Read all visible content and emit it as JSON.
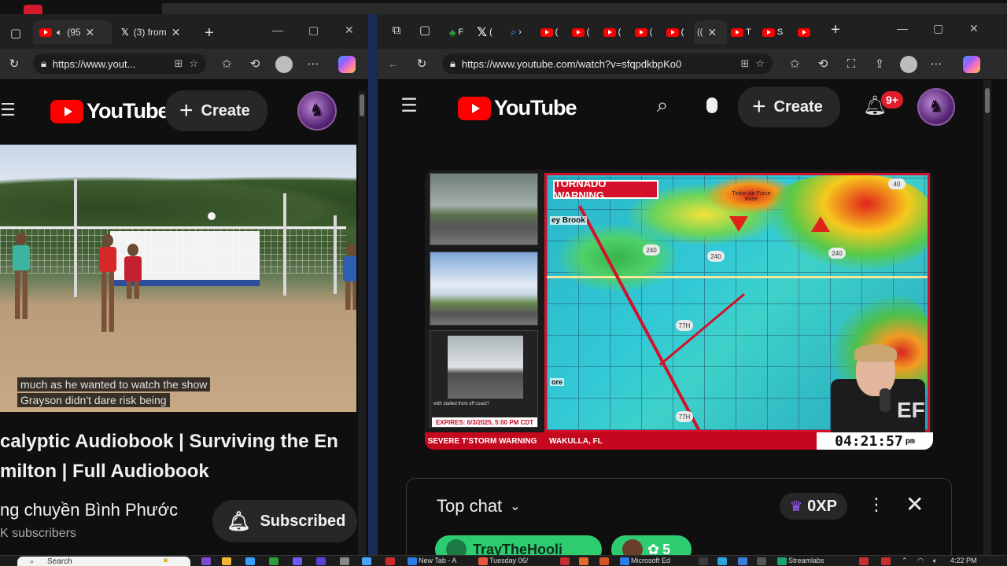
{
  "left_browser": {
    "tabs": [
      {
        "title": "(95"
      },
      {
        "title": "(3) from"
      }
    ],
    "url": "https://www.yout...",
    "youtube": {
      "logo_text": "YouTube",
      "create_label": "Create"
    },
    "video": {
      "caption_line1": "much as he wanted to watch the show",
      "caption_line2": "Grayson didn't dare risk being"
    },
    "title_line1": "calyptic Audiobook | Surviving the En",
    "title_line2": "milton | Full Audiobook",
    "channel": "ng chuyền Bình Phước",
    "subscribers": "K subscribers",
    "subscribe_label": "Subscribed"
  },
  "right_browser": {
    "tabs": [
      {
        "title": "F"
      },
      {
        "title": "("
      },
      {
        "title": "›"
      },
      {
        "title": "("
      },
      {
        "title": "("
      },
      {
        "title": "("
      },
      {
        "title": "("
      },
      {
        "title": "("
      },
      {
        "title": "(("
      },
      {
        "title": "T"
      },
      {
        "title": "S"
      }
    ],
    "url": "https://www.youtube.com/watch?v=sfqpdkbpKo0",
    "youtube": {
      "logo_text": "YouTube",
      "create_label": "Create",
      "notification_count": "9+"
    },
    "stream": {
      "warning_title": "TORNADO WARNING",
      "expires": "EXPIRES: 6/3/2025, 5:00 PM CDT",
      "ticker_left": "SEVERE T'STORM WARNING",
      "ticker_mid": "WAKULLA, FL",
      "clock": "04:21:57",
      "clock_suffix": "pm",
      "map_label_1": "ey Brook",
      "map_label_2": "ore",
      "map_label_3": "Tinker Air Force Base",
      "road_240": "240",
      "road_77h": "77H",
      "road_40": "40",
      "watermark": "EF",
      "cam3_text": "with stalled front off coast?"
    },
    "chat": {
      "title": "Top chat",
      "xp": "0XP",
      "chip1": "TrayTheHooli",
      "chip2": "5"
    }
  },
  "taskbar": {
    "search_placeholder": "Search",
    "items": [
      {
        "label": "New Tab - A"
      },
      {
        "label": "Tuesday 06/"
      },
      {
        "label": "Microsoft Ed"
      },
      {
        "label": "Streamlabs"
      }
    ],
    "time": "4:22 PM"
  },
  "colors": {
    "youtube_red": "#ff0000",
    "warning_red": "#d5102a",
    "chat_chip_green": "#2ecc71",
    "xp_purple": "#a259ff"
  }
}
